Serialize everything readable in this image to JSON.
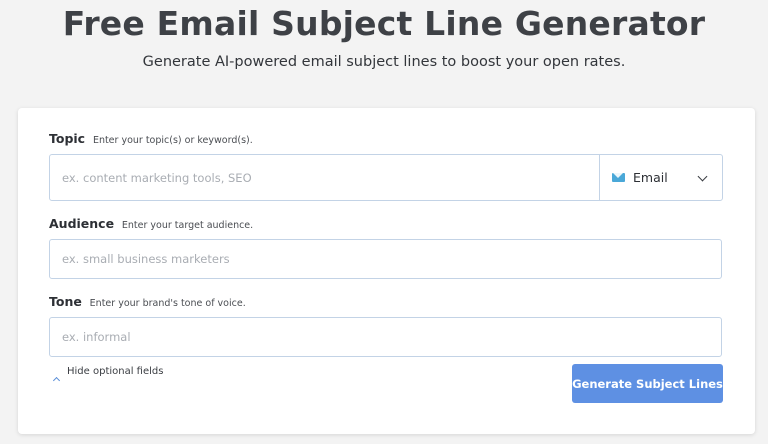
{
  "header": {
    "title": "Free Email Subject Line Generator",
    "subtitle": "Generate AI-powered email subject lines to boost your open rates."
  },
  "form": {
    "topic": {
      "label": "Topic",
      "hint": "Enter your topic(s) or keyword(s).",
      "value": "",
      "placeholder": "ex. content marketing tools, SEO",
      "type_select": {
        "icon": "envelope-icon",
        "selected": "Email"
      }
    },
    "audience": {
      "label": "Audience",
      "hint": "Enter your target audience.",
      "value": "",
      "placeholder": "ex. small business marketers"
    },
    "tone": {
      "label": "Tone",
      "hint": "Enter your brand's tone of voice.",
      "value": "",
      "placeholder": "ex. informal"
    },
    "toggle_optional": "Hide optional fields",
    "generate_label": "Generate Subject Lines"
  },
  "colors": {
    "accent": "#5e90e3",
    "title_text": "#3e4146",
    "input_border": "#c3d3e6",
    "envelope": "#4aa8d8"
  }
}
